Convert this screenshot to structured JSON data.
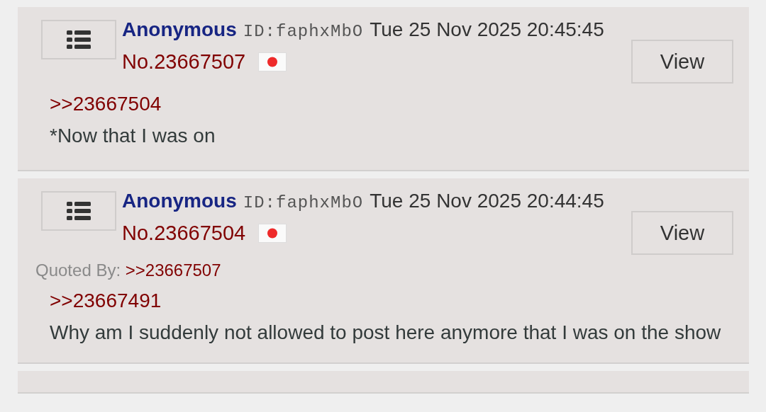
{
  "posts": [
    {
      "name": "Anonymous",
      "poster_id": "ID:faphxMbO",
      "date": "Tue 25 Nov 2025 20:45:45",
      "number": "No.23667507",
      "view_button": "View",
      "body": [
        {
          "kind": "quote",
          "text": ">>23667504"
        },
        {
          "kind": "text",
          "text": "*Now that I was on"
        }
      ]
    },
    {
      "name": "Anonymous",
      "poster_id": "ID:faphxMbO",
      "date": "Tue 25 Nov 2025 20:44:45",
      "number": "No.23667504",
      "view_button": "View",
      "quoted_by": {
        "label": "Quoted By:",
        "links": [
          ">>23667507"
        ]
      },
      "body": [
        {
          "kind": "quote",
          "text": ">>23667491"
        },
        {
          "kind": "text",
          "text": "Why am I suddenly not allowed to post here anymore that I was on the show"
        }
      ]
    }
  ]
}
